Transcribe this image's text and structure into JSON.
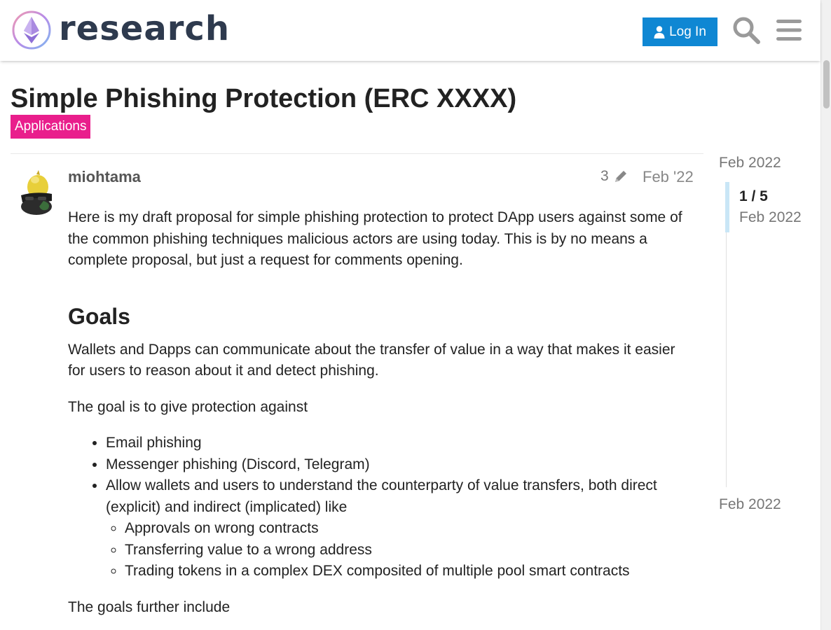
{
  "header": {
    "logo_text": "research",
    "login_label": "Log In",
    "icons": {
      "logo": "ethereum-logo-icon",
      "user": "user-icon",
      "search": "search-icon",
      "menu": "hamburger-menu-icon"
    }
  },
  "topic": {
    "title": "Simple Phishing Protection (ERC XXXX)",
    "category": "Applications",
    "category_color": "#e91e8c"
  },
  "post": {
    "author": "miohtama",
    "edit_count": "3",
    "date": "Feb '22",
    "intro": "Here is my draft proposal for simple phishing protection to protect DApp users against some of the common phishing techniques malicious actors are using today. This is by no means a complete proposal, but just a request for comments opening.",
    "heading_goals": "Goals",
    "goals_p1": "Wallets and Dapps can communicate about the transfer of value in a way that makes it easier for users to reason about it and detect phishing.",
    "goals_p2": "The goal is to give protection against",
    "bullets": [
      "Email phishing",
      "Messenger phishing (Discord, Telegram)",
      "Allow wallets and users to understand the counterparty of value transfers, both direct (explicit) and indirect (implicated) like"
    ],
    "sub_bullets": [
      "Approvals on wrong contracts",
      "Transferring value to a wrong address",
      "Trading tokens in a complex DEX composited of multiple pool smart contracts"
    ],
    "goals_p3": "The goals further include"
  },
  "timeline": {
    "start_date": "Feb 2022",
    "position": "1 / 5",
    "position_date": "Feb 2022",
    "end_date": "Feb 2022"
  },
  "colors": {
    "accent": "#0f87d3",
    "timeline_handle": "#c9e6f6"
  }
}
